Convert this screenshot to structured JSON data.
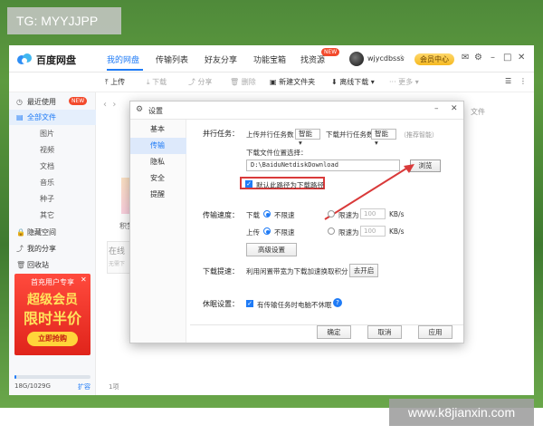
{
  "watermarks": {
    "top_left": "TG: MYYJJPP",
    "bottom_right": "www.k8jianxin.com"
  },
  "titlebar": {
    "app_name": "百度网盘",
    "tabs": [
      "我的网盘",
      "传输列表",
      "好友分享",
      "功能宝箱",
      "找资源"
    ],
    "new_badge": "NEW",
    "username": "wjycdbsss",
    "member_center": "会员中心",
    "icons": [
      "mail-icon",
      "gear-icon",
      "minimize-icon",
      "restore-icon",
      "close-icon"
    ]
  },
  "toolbar": {
    "upload": "上传",
    "download": "下载",
    "share": "分享",
    "delete": "删除",
    "new_folder": "新建文件夹",
    "offline_download": "离线下载",
    "more": "更多"
  },
  "sidebar": {
    "recent": "最近使用",
    "new_badge": "NEW",
    "all_files": "全部文件",
    "sub": [
      "图片",
      "视频",
      "文档",
      "音乐",
      "种子",
      "其它"
    ],
    "hidden": "隐藏空间",
    "my_share": "我的分享",
    "recycle": "回收站"
  },
  "ad": {
    "title": "首充用户专享",
    "line1": "超级会员",
    "line2": "限时半价",
    "button": "立即抢购"
  },
  "storage": {
    "text": "18G/1029G",
    "expand": "扩容",
    "used_fraction": 0.018
  },
  "main": {
    "partial_text": "积梦11",
    "online": "在线",
    "online_sub": "无需下",
    "file_partial": "文件",
    "status_count": "1项"
  },
  "dialog": {
    "title": "设置",
    "nav": [
      "基本",
      "传输",
      "隐私",
      "安全",
      "提醒"
    ],
    "parallel_label": "并行任务：",
    "upload_parallel": "上传并行任务数",
    "upload_parallel_value": "智能",
    "download_parallel": "下载并行任务数",
    "download_parallel_value": "智能",
    "recommend_hint": "（推荐智能）",
    "download_path_label": "下载文件位置选择：",
    "download_path": "D:\\BaiduNetdiskDownload",
    "browse": "浏览",
    "default_path_checkbox": "默认此路径为下载路径",
    "speed_label": "传输速度：",
    "download": "下载",
    "upload": "上传",
    "no_limit": "不限速",
    "limit_to": "限速为",
    "download_limit_value": "100",
    "upload_limit_value": "100",
    "unit": "KB/s",
    "advanced": "高级设置",
    "accelerate_label": "下载提速：",
    "accelerate_text": "利用闲置带宽为下载加速换取积分",
    "enable_button": "去开启",
    "sleep_label": "休眠设置：",
    "sleep_checkbox": "有传输任务时电脑不休眠",
    "ok": "确定",
    "cancel": "取消",
    "apply": "应用"
  }
}
